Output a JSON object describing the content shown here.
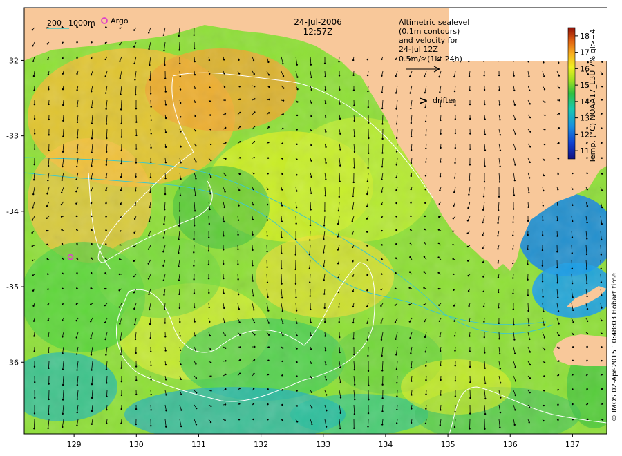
{
  "map": {
    "date": "24-Jul-2006",
    "time": "12:57Z",
    "x_ticks": [
      "129",
      "130",
      "131",
      "132",
      "133",
      "134",
      "135",
      "136",
      "137"
    ],
    "y_ticks": [
      "-32",
      "-33",
      "-34",
      "-35",
      "-36"
    ],
    "x_range_deg_e": [
      128.2,
      137.55
    ],
    "y_range_deg": [
      -31.3,
      -36.95
    ]
  },
  "legend": {
    "isobath_label": "200",
    "isobath_label_2": "1000m",
    "argo_label": "Argo",
    "drifter_label": "drifter",
    "drifter_glyph": ">",
    "altimetry_lines": [
      "Altimetric sealevel",
      "(0.1m contours)",
      "and velocity for",
      "24-Jul 12Z",
      "0.5m/s (1kt 24h)"
    ]
  },
  "colorbar": {
    "title": "Temp. (°C) NOAA17_L3U 7% ql>=4",
    "ticks": [
      "11",
      "12",
      "13",
      "14",
      "15",
      "16",
      "17",
      "18"
    ],
    "range": [
      10.5,
      18.5
    ]
  },
  "credit": "© IMOS 02-Apr-2015 10:48:03 Hobart time",
  "colors": {
    "land": "#f8c89a",
    "isobath": "#40c8c8",
    "sealevel_contour": "#ffffff",
    "argo": "#e040c8",
    "drifter": "#ff00ff",
    "arrows": "#000000"
  },
  "argo_floats": [
    {
      "lon": 128.95,
      "lat": -34.58
    }
  ]
}
